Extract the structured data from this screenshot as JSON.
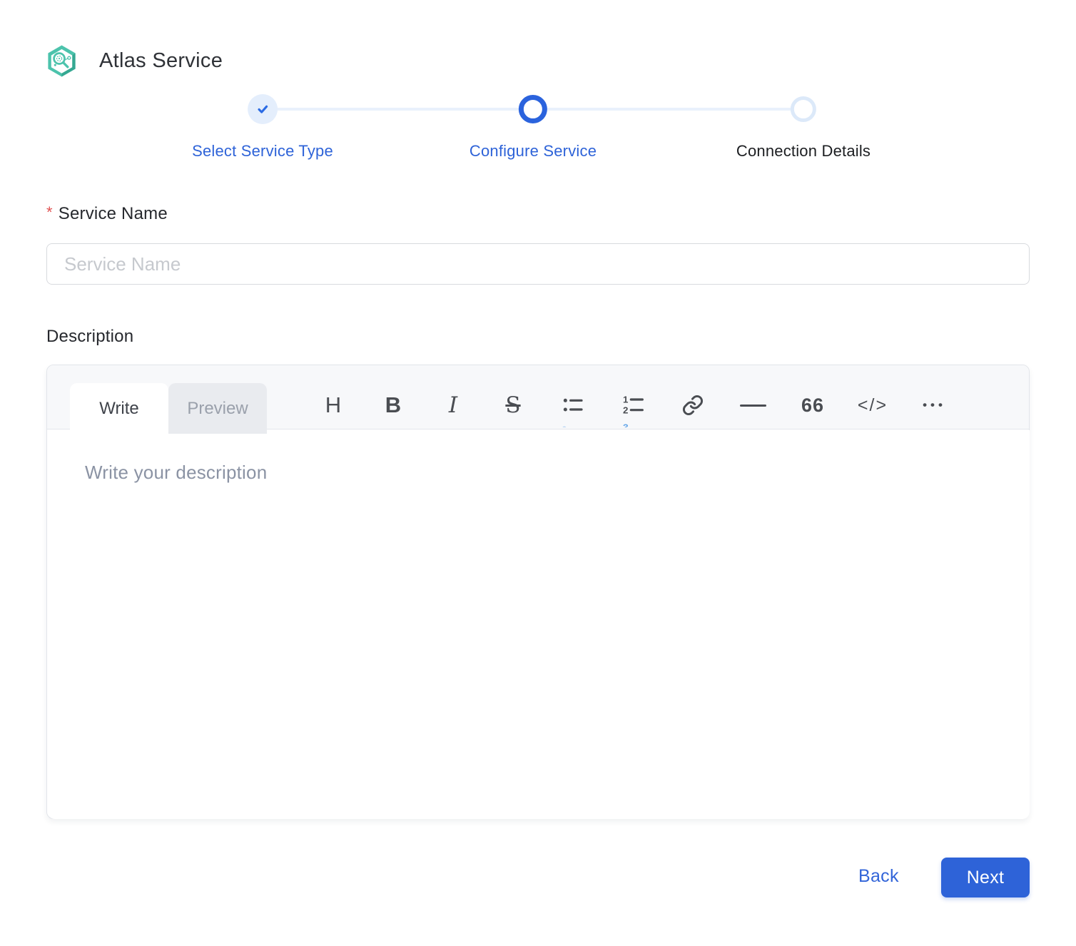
{
  "header": {
    "title": "Atlas Service"
  },
  "stepper": {
    "steps": [
      {
        "label": "Select Service Type",
        "state": "completed"
      },
      {
        "label": "Configure Service",
        "state": "active"
      },
      {
        "label": "Connection Details",
        "state": "upcoming"
      }
    ]
  },
  "form": {
    "service_name": {
      "required_marker": "*",
      "label": "Service Name",
      "placeholder": "Service Name",
      "value": ""
    },
    "description": {
      "label": "Description",
      "tabs": {
        "write": "Write",
        "preview": "Preview"
      },
      "toolbar": {
        "heading_glyph": "H",
        "bold_glyph": "B",
        "italic_glyph": "I",
        "strikethrough_glyph": "S",
        "quote_glyph": "66",
        "code_glyph": "</>",
        "more_glyph": "•••"
      },
      "placeholder": "Write your description",
      "value": ""
    }
  },
  "footer": {
    "back_label": "Back",
    "next_label": "Next"
  },
  "colors": {
    "accent_blue": "#2e63d8",
    "stepper_line": "#e9f1fc",
    "completed_circle_bg": "#e4eefc",
    "upcoming_circle_ring": "#dce9f9",
    "brand_teal": "#4cc3ac",
    "brand_teal_dark": "#35a892",
    "required_red": "#e05252",
    "toolbar_bg": "#f7f8fa",
    "icon_gray": "#4a4d52"
  }
}
